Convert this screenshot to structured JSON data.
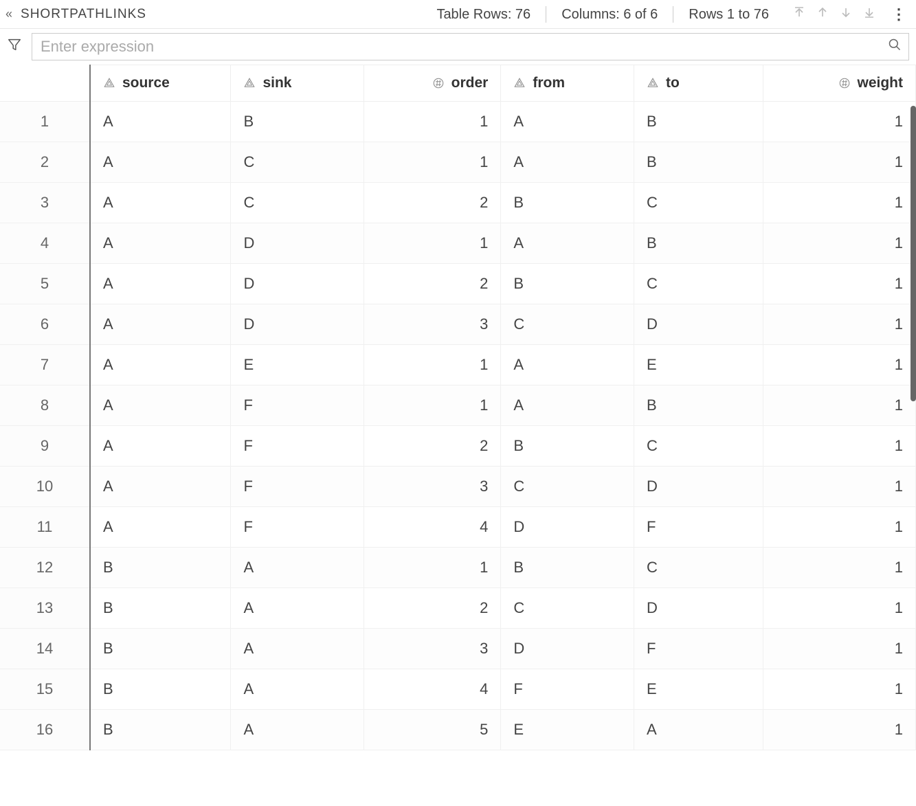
{
  "toolbar": {
    "table_name": "SHORTPATHLINKS",
    "rows_label": "Table Rows: 76",
    "cols_label": "Columns: 6 of 6",
    "range_label": "Rows 1 to 76"
  },
  "filter": {
    "placeholder": "Enter expression"
  },
  "columns": [
    {
      "key": "source",
      "label": "source",
      "type": "text"
    },
    {
      "key": "sink",
      "label": "sink",
      "type": "text"
    },
    {
      "key": "order",
      "label": "order",
      "type": "num"
    },
    {
      "key": "from",
      "label": "from",
      "type": "text"
    },
    {
      "key": "to",
      "label": "to",
      "type": "text"
    },
    {
      "key": "weight",
      "label": "weight",
      "type": "num"
    }
  ],
  "rows": [
    {
      "n": 1,
      "source": "A",
      "sink": "B",
      "order": 1,
      "from": "A",
      "to": "B",
      "weight": 1
    },
    {
      "n": 2,
      "source": "A",
      "sink": "C",
      "order": 1,
      "from": "A",
      "to": "B",
      "weight": 1
    },
    {
      "n": 3,
      "source": "A",
      "sink": "C",
      "order": 2,
      "from": "B",
      "to": "C",
      "weight": 1
    },
    {
      "n": 4,
      "source": "A",
      "sink": "D",
      "order": 1,
      "from": "A",
      "to": "B",
      "weight": 1
    },
    {
      "n": 5,
      "source": "A",
      "sink": "D",
      "order": 2,
      "from": "B",
      "to": "C",
      "weight": 1
    },
    {
      "n": 6,
      "source": "A",
      "sink": "D",
      "order": 3,
      "from": "C",
      "to": "D",
      "weight": 1
    },
    {
      "n": 7,
      "source": "A",
      "sink": "E",
      "order": 1,
      "from": "A",
      "to": "E",
      "weight": 1
    },
    {
      "n": 8,
      "source": "A",
      "sink": "F",
      "order": 1,
      "from": "A",
      "to": "B",
      "weight": 1
    },
    {
      "n": 9,
      "source": "A",
      "sink": "F",
      "order": 2,
      "from": "B",
      "to": "C",
      "weight": 1
    },
    {
      "n": 10,
      "source": "A",
      "sink": "F",
      "order": 3,
      "from": "C",
      "to": "D",
      "weight": 1
    },
    {
      "n": 11,
      "source": "A",
      "sink": "F",
      "order": 4,
      "from": "D",
      "to": "F",
      "weight": 1
    },
    {
      "n": 12,
      "source": "B",
      "sink": "A",
      "order": 1,
      "from": "B",
      "to": "C",
      "weight": 1
    },
    {
      "n": 13,
      "source": "B",
      "sink": "A",
      "order": 2,
      "from": "C",
      "to": "D",
      "weight": 1
    },
    {
      "n": 14,
      "source": "B",
      "sink": "A",
      "order": 3,
      "from": "D",
      "to": "F",
      "weight": 1
    },
    {
      "n": 15,
      "source": "B",
      "sink": "A",
      "order": 4,
      "from": "F",
      "to": "E",
      "weight": 1
    },
    {
      "n": 16,
      "source": "B",
      "sink": "A",
      "order": 5,
      "from": "E",
      "to": "A",
      "weight": 1
    }
  ]
}
